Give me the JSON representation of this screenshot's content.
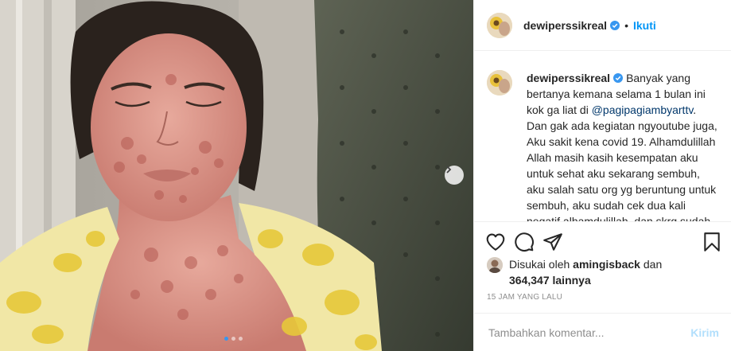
{
  "photo": {
    "carousel_dots": 3,
    "active_dot": 0,
    "next_icon": "chevron-right-icon"
  },
  "header": {
    "username": "dewiperssikreal",
    "verified_icon": "verified-badge-icon",
    "separator": "•",
    "follow_label": "Ikuti"
  },
  "caption": {
    "username": "dewiperssikreal",
    "text_before": "Banyak yang bertanya kemana selama 1 bulan ini kok ga liat di ",
    "mention": "@pagipagiambyarttv",
    "text_after": ". Dan gak ada kegiatan ngyoutube juga, Aku sakit kena covid 19. Alhamdulillah Allah masih kasih kesempatan aku untuk sehat aku sekarang sembuh, aku salah satu org yg beruntung untuk sembuh, aku sudah cek dua kali negatif alhamdulillah. dan skrg sudah"
  },
  "actions": {
    "like_icon": "heart-icon",
    "comment_icon": "comment-icon",
    "share_icon": "share-icon",
    "save_icon": "bookmark-icon"
  },
  "likes": {
    "prefix": "Disukai oleh",
    "user": "amingisback",
    "and": "dan",
    "count": "364,347",
    "suffix": "lainnya"
  },
  "timestamp": "15 JAM YANG LALU",
  "comment": {
    "placeholder": "Tambahkan komentar...",
    "post_label": "Kirim"
  },
  "colors": {
    "accent": "#0095f6",
    "post_disabled": "#b2dffc",
    "muted": "#8e8e8e"
  }
}
